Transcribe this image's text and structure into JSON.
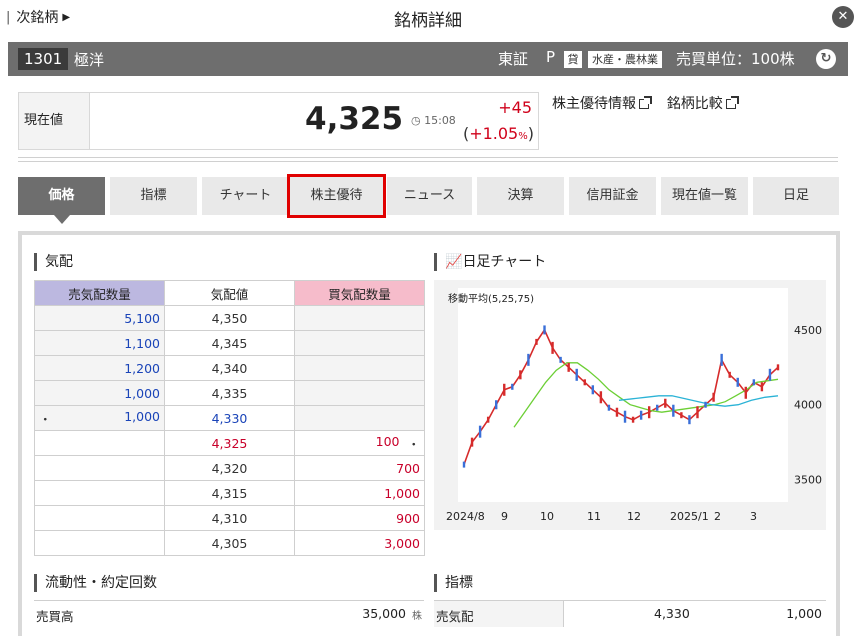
{
  "nav": {
    "next_label": "次銘柄",
    "title": "銘柄詳細"
  },
  "stock": {
    "code": "1301",
    "name": "極洋",
    "exchange": "東証",
    "market": "P",
    "loan_badge": "貸",
    "sector": "水産・農林業",
    "trade_unit": "売買単位：100株"
  },
  "price": {
    "label": "現在値",
    "value": "4,325",
    "time": "15:08",
    "change": "+45",
    "change_pct_open": "(",
    "change_pct": "+1.05",
    "pct_sign": "%",
    "change_pct_close": ")"
  },
  "links": {
    "yutai": "株主優待情報",
    "compare": "銘柄比較"
  },
  "tabs": [
    "価格",
    "指標",
    "チャート",
    "株主優待",
    "ニュース",
    "決算",
    "信用証金",
    "現在値一覧",
    "日足"
  ],
  "kehai": {
    "title": "気配",
    "headers": {
      "ask": "売気配数量",
      "price": "気配値",
      "bid": "買気配数量"
    },
    "rows": [
      {
        "ask": "5,100",
        "price": "4,350",
        "bid": ""
      },
      {
        "ask": "1,100",
        "price": "4,345",
        "bid": ""
      },
      {
        "ask": "1,200",
        "price": "4,340",
        "bid": ""
      },
      {
        "ask": "1,000",
        "price": "4,335",
        "bid": ""
      },
      {
        "ask": "1,000",
        "price": "4,330",
        "bid": ""
      },
      {
        "ask": "",
        "price": "4,325",
        "bid": "100"
      },
      {
        "ask": "",
        "price": "4,320",
        "bid": "700"
      },
      {
        "ask": "",
        "price": "4,315",
        "bid": "1,000"
      },
      {
        "ask": "",
        "price": "4,310",
        "bid": "900"
      },
      {
        "ask": "",
        "price": "4,305",
        "bid": "3,000"
      }
    ],
    "marker": "・"
  },
  "chart_section": {
    "title": "日足チャート"
  },
  "chart_data": {
    "type": "line",
    "legend_text": "移動平均(5,25,75)",
    "x_ticks": [
      "2024/8",
      "9",
      "10",
      "11",
      "12",
      "2025/1",
      "2",
      "3"
    ],
    "y_ticks": [
      "4500",
      "4000",
      "3500"
    ],
    "ylim": [
      3350,
      4700
    ],
    "series": [
      {
        "values": [
          3600,
          3750,
          3820,
          3900,
          4000,
          4100,
          4120,
          4200,
          4300,
          4420,
          4500,
          4380,
          4300,
          4250,
          4200,
          4150,
          4100,
          4050,
          3980,
          3950,
          3920,
          3900,
          3930,
          3950,
          3980,
          4010,
          3960,
          3930,
          3900,
          3950,
          4000,
          4050,
          4300,
          4200,
          4150,
          4080,
          4150,
          4120,
          4200,
          4250
        ]
      },
      {
        "values": [
          3850,
          3950,
          4050,
          4150,
          4230,
          4280,
          4280,
          4230,
          4170,
          4100,
          4050,
          4000,
          3980,
          3960,
          3950,
          3960,
          3970,
          3980,
          3990,
          4000,
          4020,
          4060,
          4100,
          4150,
          4160,
          4170
        ]
      },
      {
        "values": [
          4030,
          4040,
          4050,
          4060,
          4060,
          4040,
          4020,
          4000,
          3990,
          4000,
          4030,
          4050,
          4060
        ]
      }
    ]
  },
  "liquidity": {
    "title": "流動性・約定回数",
    "label": "売買高",
    "value": "35,000",
    "unit": "株"
  },
  "indicator": {
    "title": "指標",
    "label": "売気配",
    "price": "4,330",
    "qty": "1,000"
  },
  "colors": {
    "accent_red": "#d0021b",
    "ask_blue": "#1a44b8",
    "ask_header": "#bcb8e0",
    "bid_header": "#f6bccb"
  }
}
